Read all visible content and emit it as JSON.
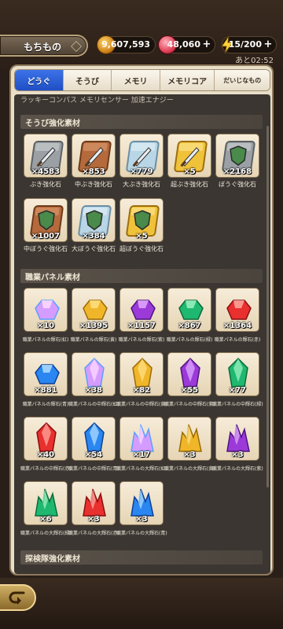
{
  "header": {
    "title": "もちもの",
    "gold": "9,607,593",
    "gems": "48,060",
    "energy": "15/200",
    "timer": "あと02:52"
  },
  "tabs": [
    "どうぐ",
    "そうび",
    "メモリ",
    "メモリコア",
    "だいじなもの"
  ],
  "active_tab": "どうぐ",
  "cut_row_text": "ラッキーコンパス  メモリセンサー  加速エナジー",
  "sections": [
    {
      "title": "そうび強化素材",
      "items": [
        {
          "icon": "sword-iron-icon",
          "count": "×4583",
          "name": "ぶき強化石"
        },
        {
          "icon": "sword-bronze-icon",
          "count": "×853",
          "name": "中ぶき強化石"
        },
        {
          "icon": "sword-silver-icon",
          "count": "×779",
          "name": "大ぶき強化石"
        },
        {
          "icon": "sword-gold-icon",
          "count": "×5",
          "name": "超ぶき強化石"
        },
        {
          "icon": "shield-iron-icon",
          "count": "×2168",
          "name": "ぼうぐ強化石"
        },
        {
          "icon": "shield-bronze-icon",
          "count": "×1007",
          "name": "中ぼうぐ強化石"
        },
        {
          "icon": "shield-silver-icon",
          "count": "×384",
          "name": "大ぼうぐ強化石"
        },
        {
          "icon": "shield-gold-icon",
          "count": "×5",
          "name": "超ぼうぐ強化石"
        }
      ]
    },
    {
      "title": "職業パネル素材",
      "items": [
        {
          "icon": "rainbow-small-gem-icon",
          "count": "×10",
          "name": "職業パネルの輝石(虹)"
        },
        {
          "icon": "yellow-small-gem-icon",
          "count": "×1395",
          "name": "職業パネルの輝石(黄)"
        },
        {
          "icon": "purple-small-gem-icon",
          "count": "×1157",
          "name": "職業パネルの輝石(紫)"
        },
        {
          "icon": "green-small-gem-icon",
          "count": "×867",
          "name": "職業パネルの輝石(緑)"
        },
        {
          "icon": "red-small-gem-icon",
          "count": "×1364",
          "name": "職業パネルの輝石(赤)"
        },
        {
          "icon": "blue-small-gem-icon",
          "count": "×881",
          "name": "職業パネルの輝石(青)"
        },
        {
          "icon": "rainbow-mid-gem-icon",
          "count": "×38",
          "name": "職業パネルの中輝石(虹)"
        },
        {
          "icon": "yellow-mid-gem-icon",
          "count": "×82",
          "name": "職業パネルの中輝石(黄)"
        },
        {
          "icon": "purple-mid-gem-icon",
          "count": "×55",
          "name": "職業パネルの中輝石(紫)"
        },
        {
          "icon": "green-mid-gem-icon",
          "count": "×77",
          "name": "職業パネルの中輝石(緑)"
        },
        {
          "icon": "red-mid-gem-icon",
          "count": "×40",
          "name": "職業パネルの中輝石(赤)"
        },
        {
          "icon": "blue-mid-gem-icon",
          "count": "×54",
          "name": "職業パネルの中輝石(青)"
        },
        {
          "icon": "rainbow-large-gem-icon",
          "count": "×17",
          "name": "職業パネルの大輝石(虹)"
        },
        {
          "icon": "yellow-large-gem-icon",
          "count": "×3",
          "name": "職業パネルの大輝石(黄)"
        },
        {
          "icon": "purple-large-gem-icon",
          "count": "×3",
          "name": "職業パネルの大輝石(紫)"
        },
        {
          "icon": "green-large-gem-icon",
          "count": "×6",
          "name": "職業パネルの大輝石(緑)"
        },
        {
          "icon": "red-large-gem-icon",
          "count": "×3",
          "name": "職業パネルの大輝石(赤)"
        },
        {
          "icon": "blue-large-gem-icon",
          "count": "×3",
          "name": "職業パネルの大輝石(青)"
        }
      ]
    },
    {
      "title": "探検隊強化素材",
      "items": []
    }
  ],
  "colors": {
    "tab_active": "#2f5fd6",
    "panel_bg": "#3b3631",
    "tile_bg": "#f1e4c9"
  }
}
